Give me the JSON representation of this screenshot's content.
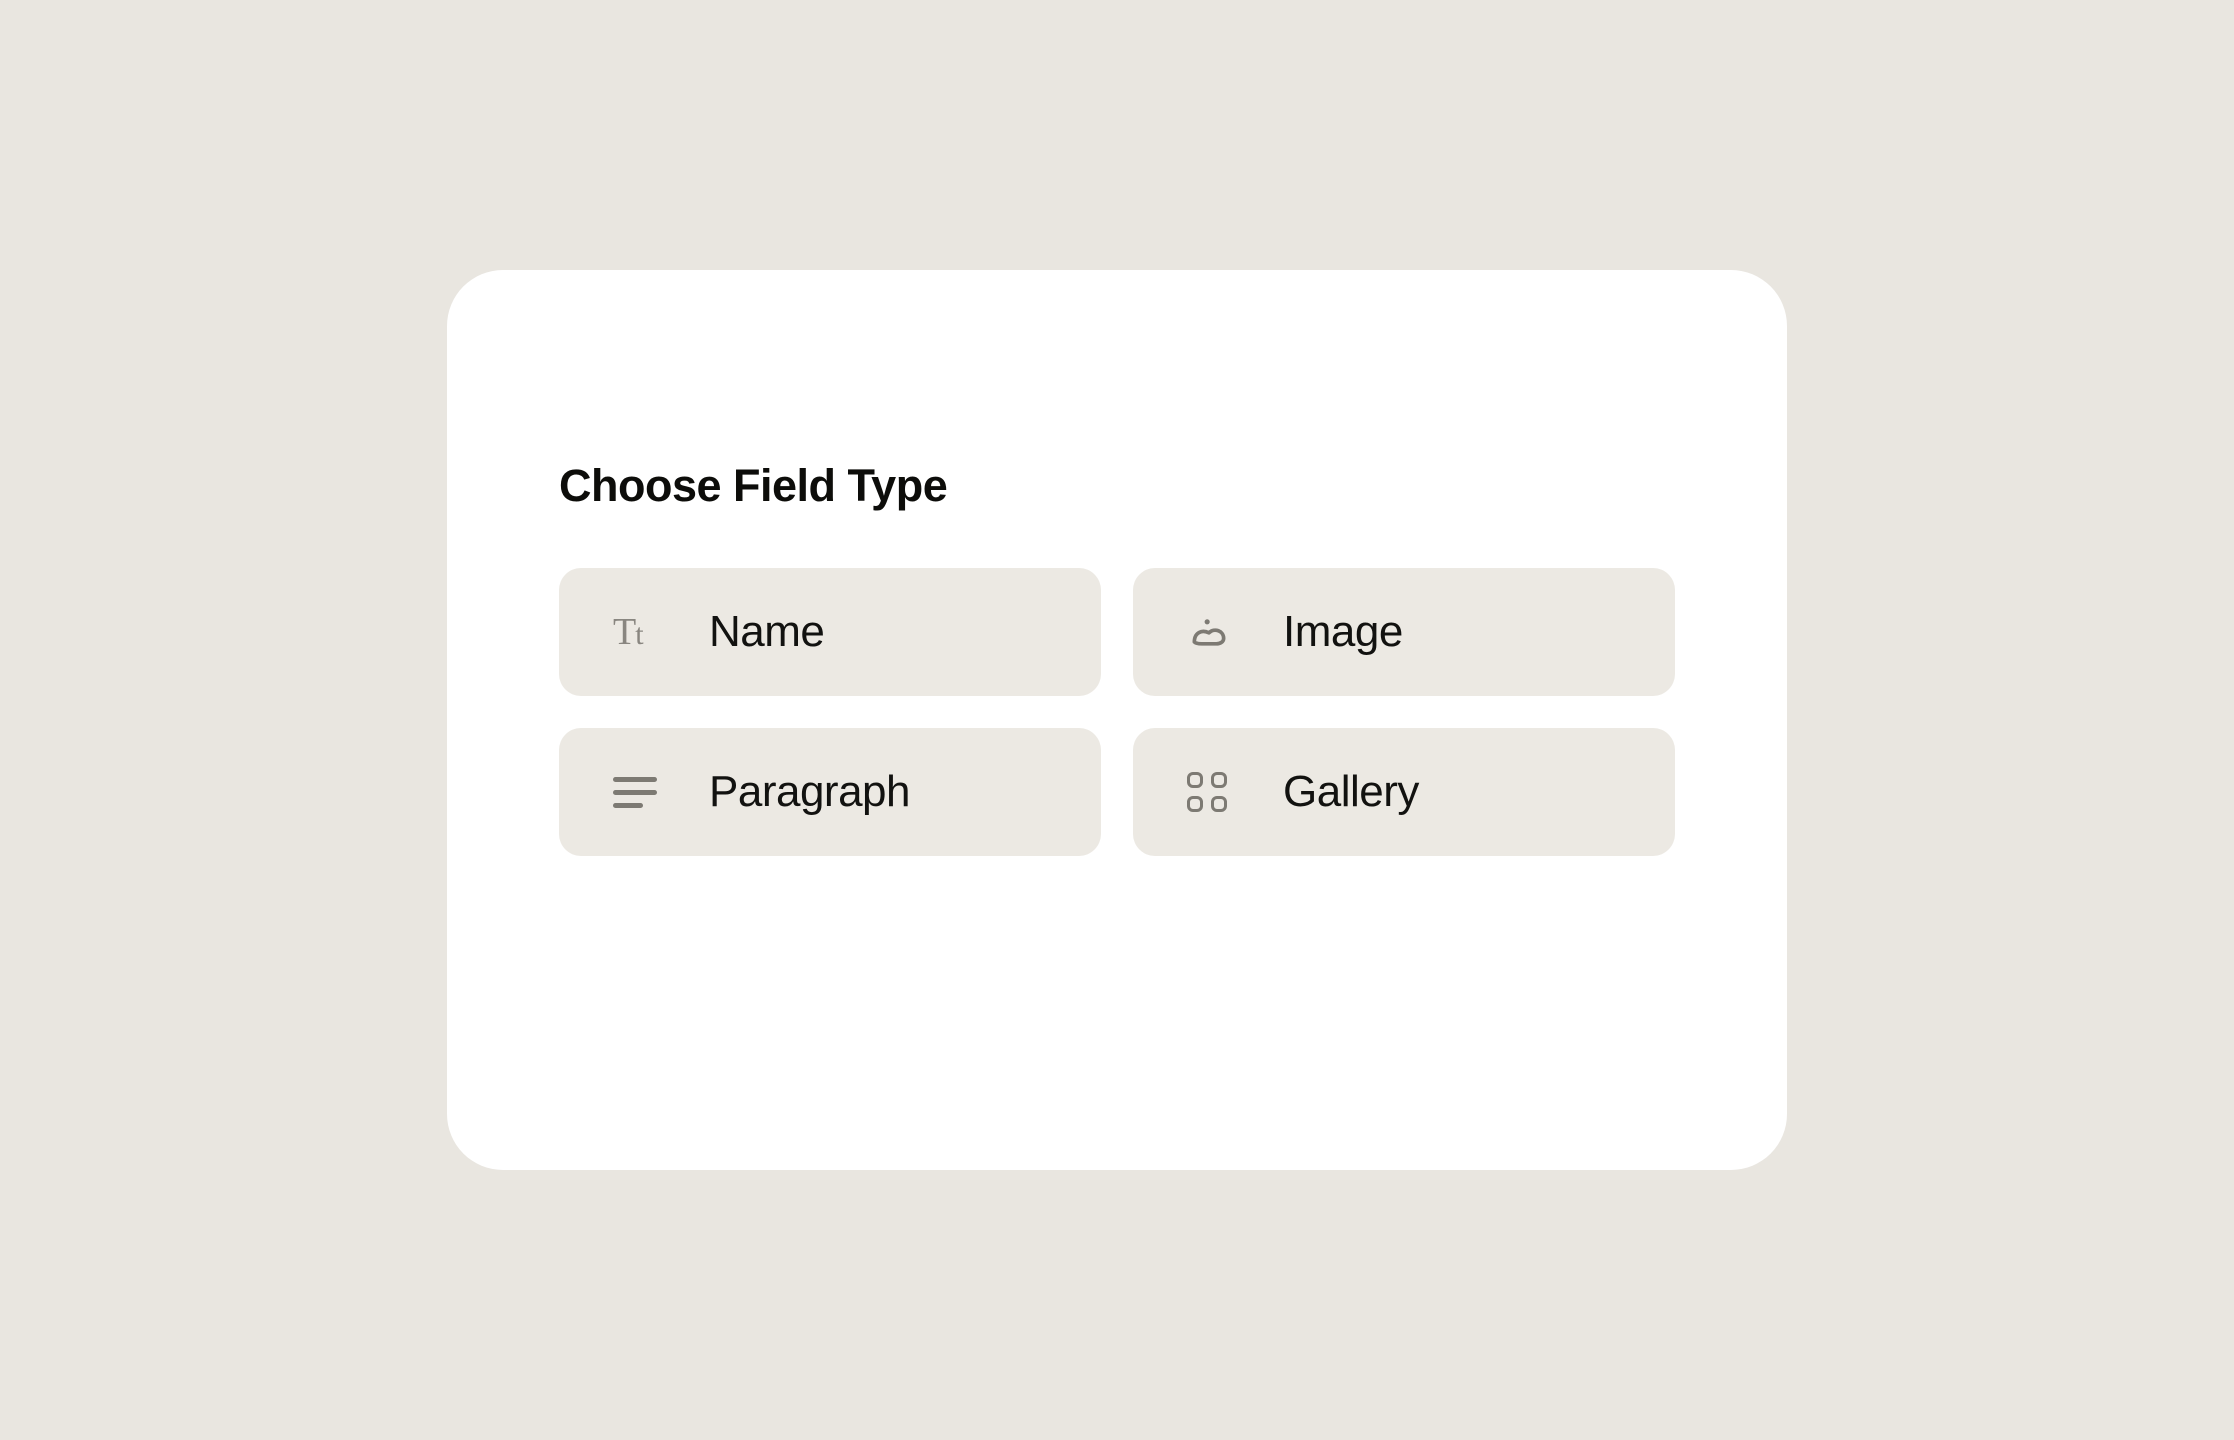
{
  "modal": {
    "title": "Choose Field Type",
    "options": [
      {
        "label": "Name",
        "icon": "text-icon"
      },
      {
        "label": "Image",
        "icon": "image-icon"
      },
      {
        "label": "Paragraph",
        "icon": "paragraph-icon"
      },
      {
        "label": "Gallery",
        "icon": "gallery-icon"
      }
    ]
  }
}
